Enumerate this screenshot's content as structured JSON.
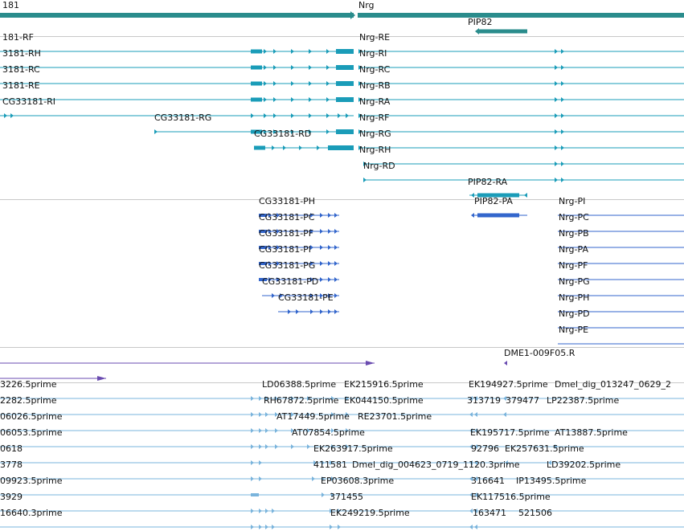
{
  "colors": {
    "gene": "#2a8c8c",
    "transcript": "#1a9cb8",
    "polypeptide": "#3366cc",
    "probe": "#6a4bb0",
    "est": "#7ab4dc",
    "separator": "#c8c8c8"
  },
  "gene_labels": [
    "181",
    "Nrg",
    "PIP82"
  ],
  "transcript_labels": [
    "181-RF",
    "3181-RH",
    "3181-RC",
    "3181-RE",
    "CG33181-RI",
    "CG33181-RG",
    "CG33181-RD",
    "Nrg-RE",
    "Nrg-RI",
    "Nrg-RC",
    "Nrg-RB",
    "Nrg-RA",
    "Nrg-RF",
    "Nrg-RG",
    "Nrg-RH",
    "Nrg-RD",
    "PIP82-RA"
  ],
  "polypeptide_labels": [
    "CG33181-PH",
    "CG33181-PC",
    "CG33181-PF",
    "CG33181-PI",
    "CG33181-PG",
    "CG33181-PD",
    "CG33181-PE",
    "PIP82-PA",
    "Nrg-PI",
    "Nrg-PC",
    "Nrg-PB",
    "Nrg-PA",
    "Nrg-PF",
    "Nrg-PG",
    "Nrg-PH",
    "Nrg-PD",
    "Nrg-PE"
  ],
  "probe_labels": [
    "DME1-009F05.R"
  ],
  "est_labels": [
    "3226.5prime",
    "2282.5prime",
    "06026.5prime",
    "06053.5prime",
    "0618",
    "3778",
    "09923.5prime",
    "3929",
    "16640.3prime",
    "LD06388.5prime",
    "EK215916.5prime",
    "RH67872.5prime",
    "EK044150.5prime",
    "AT17449.5prime",
    "RE23701.5prime",
    "AT07854.5prime",
    "EK263917.5prime",
    "411581",
    "Dmel_dig_004623_0719_1120.3prime",
    "EP03608.3prime",
    "371455",
    "EK249219.5prime",
    "EK194927.5prime",
    "Dmel_dig_013247_0629_2",
    "313719",
    "379477",
    "LP22387.5prime",
    "EK195717.5prime",
    "AT13887.5prime",
    "92796",
    "EK257631.5prime",
    "LD39202.5prime",
    "316641",
    "IP13495.5prime",
    "EK117516.5prime",
    "163471",
    "521506"
  ]
}
